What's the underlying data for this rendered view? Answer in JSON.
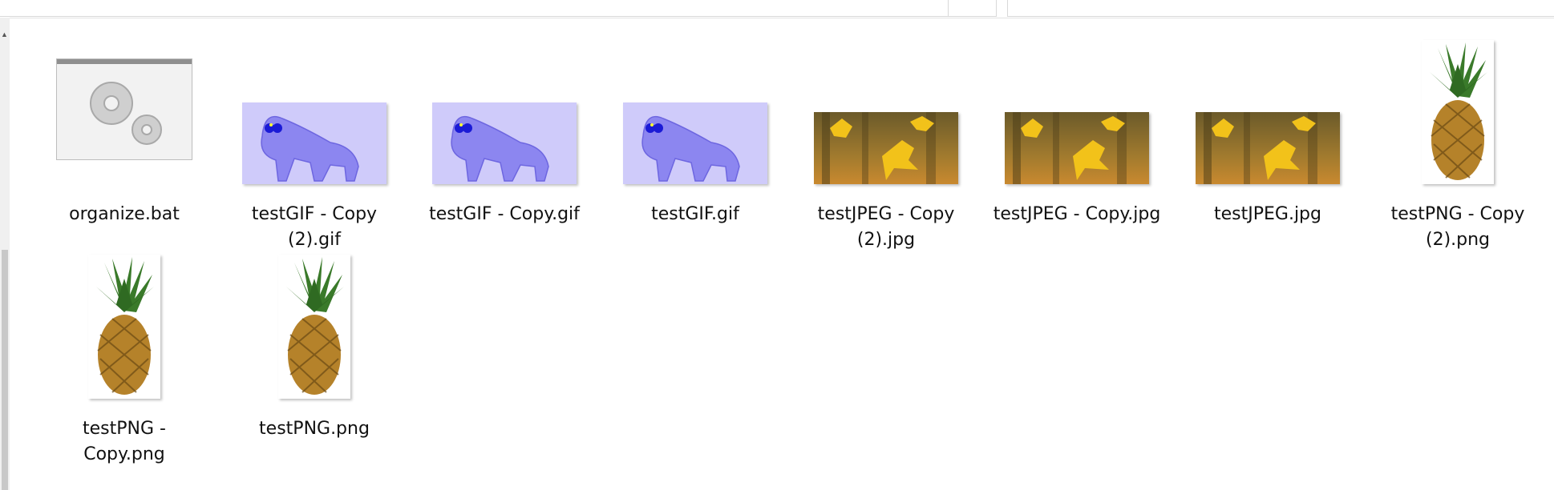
{
  "colors": {
    "gif_bg": "#cfcbfa",
    "cat": "#8c86f0",
    "leaf": "#f2c21a"
  },
  "files": [
    {
      "name": "organize.bat",
      "kind": "bat",
      "icon": "gear-icon"
    },
    {
      "name": "testGIF - Copy (2).gif",
      "kind": "gif"
    },
    {
      "name": "testGIF - Copy.gif",
      "kind": "gif"
    },
    {
      "name": "testGIF.gif",
      "kind": "gif"
    },
    {
      "name": "testJPEG - Copy (2).jpg",
      "kind": "jpg"
    },
    {
      "name": "testJPEG - Copy.jpg",
      "kind": "jpg"
    },
    {
      "name": "testJPEG.jpg",
      "kind": "jpg"
    },
    {
      "name": "testPNG - Copy (2).png",
      "kind": "png"
    },
    {
      "name": "testPNG - Copy.png",
      "kind": "png"
    },
    {
      "name": "testPNG.png",
      "kind": "png"
    }
  ]
}
